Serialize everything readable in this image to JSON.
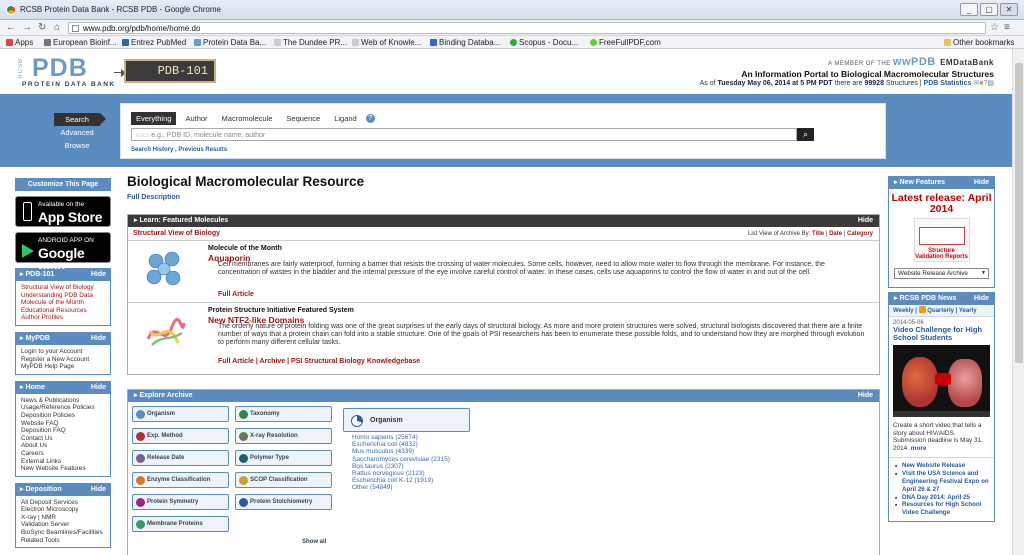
{
  "window": {
    "title": "RCSB Protein Data Bank - RCSB PDB - Google Chrome",
    "controls": [
      "_",
      "▢",
      "✕"
    ]
  },
  "browser": {
    "url": "www.pdb.org/pdb/home/home.do",
    "bookmarks": [
      "Apps",
      "European Bioinf...",
      "Entrez PubMed",
      "Protein Data Ba...",
      "The Dundee PR...",
      "Web of Knowle...",
      "Binding Databa...",
      "Scopus - Docu...",
      "FreeFullPDF.com",
      "Other bookmarks"
    ]
  },
  "header": {
    "rcsb": "RCSB",
    "logo": "PDB",
    "logo_sub": "PROTEIN DATA BANK",
    "pdb101": "PDB-101",
    "member_prefix": "A MEMBER OF THE",
    "member_wpdb": "wwPDB",
    "emdb": "EMDataBank",
    "portal": "An Information Portal to Biological Macromolecular Structures",
    "asof_prefix": "As of",
    "asof_date": "Tuesday May 06, 2014 at 5 PM PDT",
    "asof_mid": "there are",
    "structure_count": "99928",
    "asof_suffix": "Structures",
    "stats": "PDB Statistics"
  },
  "search": {
    "nav": [
      "Search",
      "Advanced",
      "Browse"
    ],
    "tabs": [
      "Everything",
      "Author",
      "Macromolecule",
      "Sequence",
      "Ligand"
    ],
    "placeholder": "e.g., PDB ID, molecule name, author",
    "history": "Search History , Previous Results"
  },
  "left": {
    "customize": "Customize This Page",
    "appstore_small": "Available on the",
    "appstore_big": "App Store",
    "android_small": "ANDROID APP ON",
    "android_big": "Google play",
    "hide": "Hide",
    "boxes": [
      {
        "title": "PDB-101",
        "items": [
          "Structural View of Biology",
          "Understanding PDB Data",
          "Molecule of the Month",
          "Educational Resources",
          "Author Profiles"
        ]
      },
      {
        "title": "MyPDB",
        "items": [
          "Login to your Account",
          "Register a New Account",
          "MyPDB Help Page"
        ]
      },
      {
        "title": "Home",
        "items": [
          "News & Publications",
          "Usage/Reference Policies",
          "Deposition Policies",
          "Website FAQ",
          "Deposition FAQ",
          "Contact Us",
          "About Us",
          "Careers",
          "External Links",
          "New Website Features"
        ]
      },
      {
        "title": "Deposition",
        "items": [
          "All Deposit Services",
          "Electron Microscopy",
          "X-ray | NMR",
          "Validation Server",
          "BioSync Beamlines/Facilities",
          "Related Tools"
        ]
      }
    ]
  },
  "main": {
    "title": "Biological Macromolecular Resource",
    "full_description": "Full Description",
    "featured": {
      "header": "Learn: Featured Molecules",
      "hide": "Hide",
      "subtitle": "Structural View of Biology",
      "list_view_label": "List View of Archive By:",
      "list_view": [
        "Title",
        "Date",
        "Category"
      ],
      "molecules": [
        {
          "category": "Molecule of the Month",
          "name": "Aquaporin",
          "desc": "Cell membranes are fairly waterproof, forming a barrier that resists the crossing of water molecules. Some cells, however, need to allow more water to flow through the membrane. For instance, the concentration of wastes in the bladder and the internal pressure of the eye involve careful control of water. In these cases, cells use aquaporins to control the flow of water in and out of the cell.",
          "more": "Full Article"
        },
        {
          "category": "Protein Structure Initiative Featured System",
          "name": "New NTF2-like Domains",
          "desc": "The orderly nature of protein folding was one of the great surprises of the early days of structural biology. As more and more protein structures were solved, structural biologists discovered that there are a finite number of ways that a protein chain can fold into a stable structure. One of the goals of PSI researchers has been to enumerate these possible folds, and to understand how they are morphed through evolution to perform many different cellular tasks.",
          "more": "Full Article | Archive | PSI Structural Biology Knowledgebase"
        }
      ]
    },
    "archive": {
      "header": "Explore Archive",
      "hide": "Hide",
      "categories": [
        "Organism",
        "Taxonomy",
        "Exp. Method",
        "X-ray Resolution",
        "Release Date",
        "Polymer Type",
        "Enzyme Classification",
        "SCOP Classification",
        "Protein Symmetry",
        "Protein Stoichiometry",
        "Membrane Proteins"
      ],
      "show_all": "Show all",
      "selected": "Organism",
      "organisms": [
        "Homo sapiens (25674)",
        "Escherichia coli (4832)",
        "Mus musculus (4339)",
        "Saccharomyces cerevisiae (2315)",
        "Bos taurus (2307)",
        "Rattus norvegicus (2123)",
        "Escherichia coli K-12 (1919)",
        "Other (54849)"
      ]
    }
  },
  "right": {
    "features": {
      "title": "New Features",
      "hide": "Hide",
      "latest": "Latest release: April 2014",
      "poster_text": "Structure Validation Reports",
      "select": "Website Release Archive"
    },
    "news": {
      "title": "RCSB PDB News",
      "hide": "Hide",
      "weekly": "Weekly",
      "quarterly": "Quarterly",
      "yearly": "Yearly",
      "date": "2014-05-06",
      "headline": "Video Challenge for High School Students",
      "text": "Create a short video that tells a story about HIV/AIDS. Submission deadline is May 31, 2014.",
      "more": "more",
      "items": [
        "New Website Release",
        "Visit the USA Science and Engineering Festival Expo on April 26 & 27",
        "DNA Day 2014: April 25",
        "Resources for High School Video Challenge"
      ]
    }
  }
}
